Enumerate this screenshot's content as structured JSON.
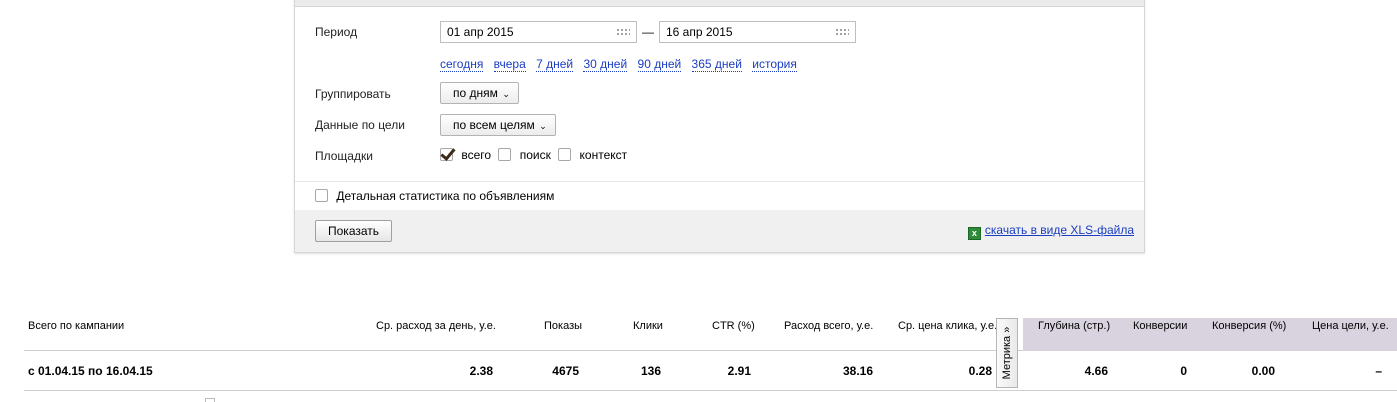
{
  "filter": {
    "period_label": "Период",
    "date_from": "01 апр 2015",
    "date_to": "16 апр 2015",
    "date_sep": "—",
    "quick_ranges": [
      "сегодня",
      "вчера",
      "7 дней",
      "30 дней",
      "90 дней",
      "365 дней",
      "история"
    ],
    "group_label": "Группировать",
    "group_value": "по дням",
    "goal_label": "Данные по цели",
    "goal_value": "по всем целям",
    "platforms_label": "Площадки",
    "platforms": [
      {
        "label": "всего",
        "checked": true
      },
      {
        "label": "поиск",
        "checked": false
      },
      {
        "label": "контекст",
        "checked": false
      }
    ],
    "detail_label": "Детальная статистика по объявлениям",
    "show_button": "Показать",
    "xls_link": "скачать в виде XLS-файла"
  },
  "stats": {
    "headers": {
      "campaign": "Всего по кампании",
      "avg_daily": "Ср. расход за день, у.е.",
      "impressions": "Показы",
      "clicks": "Клики",
      "ctr": "CTR (%)",
      "spend": "Расход всего, у.е.",
      "avg_cpc": "Ср. цена клика, у.е.",
      "depth": "Глубина (стр.)",
      "conversions": "Конверсии",
      "conv_rate": "Конверсия (%)",
      "goal_cost": "Цена цели, у.е."
    },
    "row": {
      "campaign": "с 01.04.15 по 16.04.15",
      "avg_daily": "2.38",
      "impressions": "4675",
      "clicks": "136",
      "ctr": "2.91",
      "spend": "38.16",
      "avg_cpc": "0.28",
      "depth": "4.66",
      "conversions": "0",
      "conv_rate": "0.00",
      "goal_cost": "–"
    },
    "metrika_tab": "Метрика »"
  }
}
